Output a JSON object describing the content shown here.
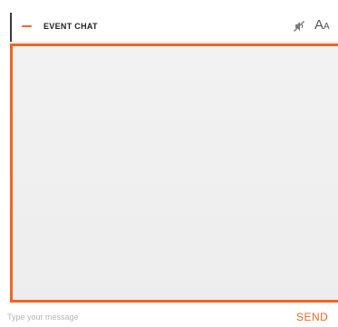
{
  "chat": {
    "title": "EVENT CHAT",
    "collapse_icon": "minus-icon",
    "mute_icon": "mute-icon",
    "font_size_icon": "font-size-icon",
    "font_size_label_large": "A",
    "font_size_label_small": "A",
    "accent_color": "#f26522"
  },
  "composer": {
    "placeholder": "Type your message",
    "value": "",
    "send_label": "SEND"
  }
}
